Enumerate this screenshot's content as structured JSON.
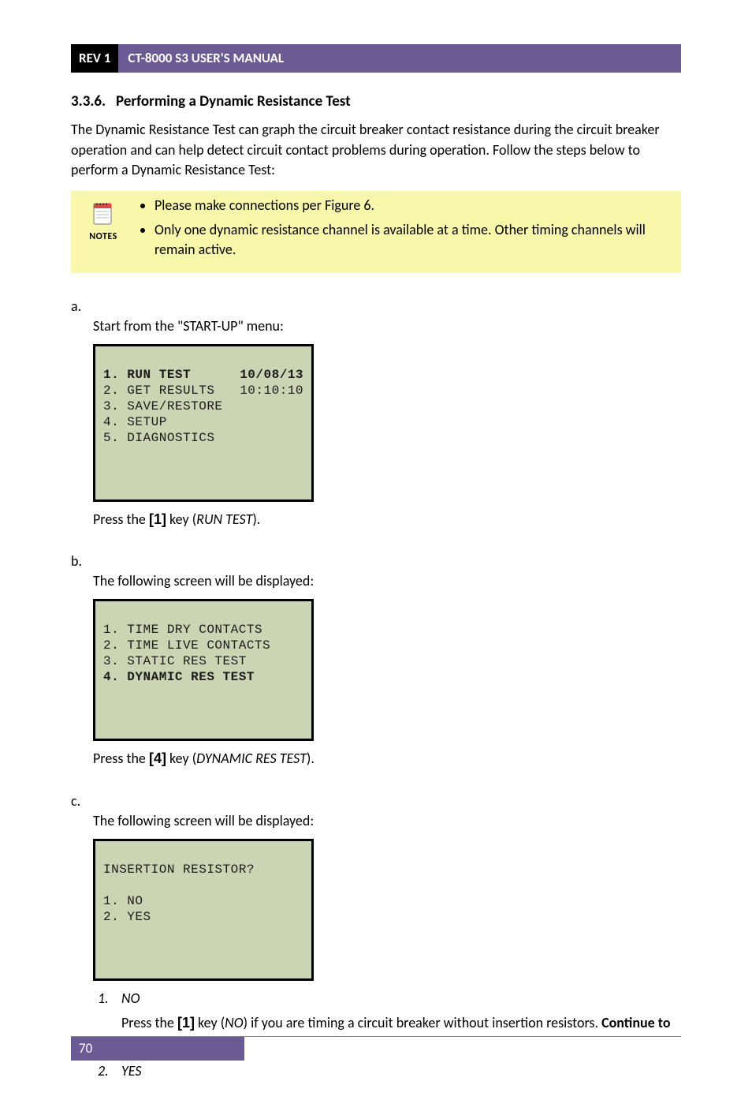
{
  "header": {
    "rev": "REV 1",
    "title": "CT-8000 S3 USER'S MANUAL"
  },
  "section": {
    "number": "3.3.6.",
    "title": "Performing a Dynamic Resistance Test"
  },
  "intro": "The Dynamic Resistance Test can graph the circuit breaker contact resistance during the circuit breaker operation and can help detect circuit contact problems during operation. Follow the steps below to perform a Dynamic Resistance Test:",
  "notes": {
    "label": "NOTES",
    "items": [
      "Please make connections per Figure 6.",
      "Only one dynamic resistance channel is available at a time. Other timing channels will remain active."
    ]
  },
  "steps": {
    "a": {
      "marker": "a.",
      "text": "Start from the \"START-UP\" menu:",
      "lcd": {
        "row1_left": "1. RUN TEST",
        "row1_right": "10/08/13",
        "row2_left": "2. GET RESULTS",
        "row2_right": "10:10:10",
        "row3": "3. SAVE/RESTORE",
        "row4": "4. SETUP",
        "row5": "5. DIAGNOSTICS"
      },
      "instr_pre": "Press the ",
      "instr_key": "[1]",
      "instr_mid": " key (",
      "instr_em": "RUN TEST",
      "instr_post": ")."
    },
    "b": {
      "marker": "b.",
      "text": "The following screen will be displayed:",
      "lcd": {
        "row1": "1. TIME DRY CONTACTS",
        "row2": "2. TIME LIVE CONTACTS",
        "row3": "3. STATIC RES TEST",
        "row4": "4. DYNAMIC RES TEST"
      },
      "instr_pre": "Press the ",
      "instr_key": "[4]",
      "instr_mid": " key (",
      "instr_em": "DYNAMIC RES TEST",
      "instr_post": ")."
    },
    "c": {
      "marker": "c.",
      "text": "The following screen will be displayed:",
      "lcd": {
        "row1": "INSERTION RESISTOR?",
        "row2": "",
        "row3": "1. NO",
        "row4": "2. YES"
      },
      "sub": {
        "opt1": {
          "marker": "1.",
          "head": "NO",
          "body_pre": "Press the ",
          "body_key": "[1]",
          "body_mid": " key (",
          "body_em": "NO",
          "body_post": ") if you are timing a circuit breaker without insertion resistors. ",
          "body_bold": "Continue to step d",
          "body_end": "."
        },
        "opt2": {
          "marker": "2.",
          "head": "YES"
        }
      }
    }
  },
  "footer": {
    "page": "70"
  }
}
